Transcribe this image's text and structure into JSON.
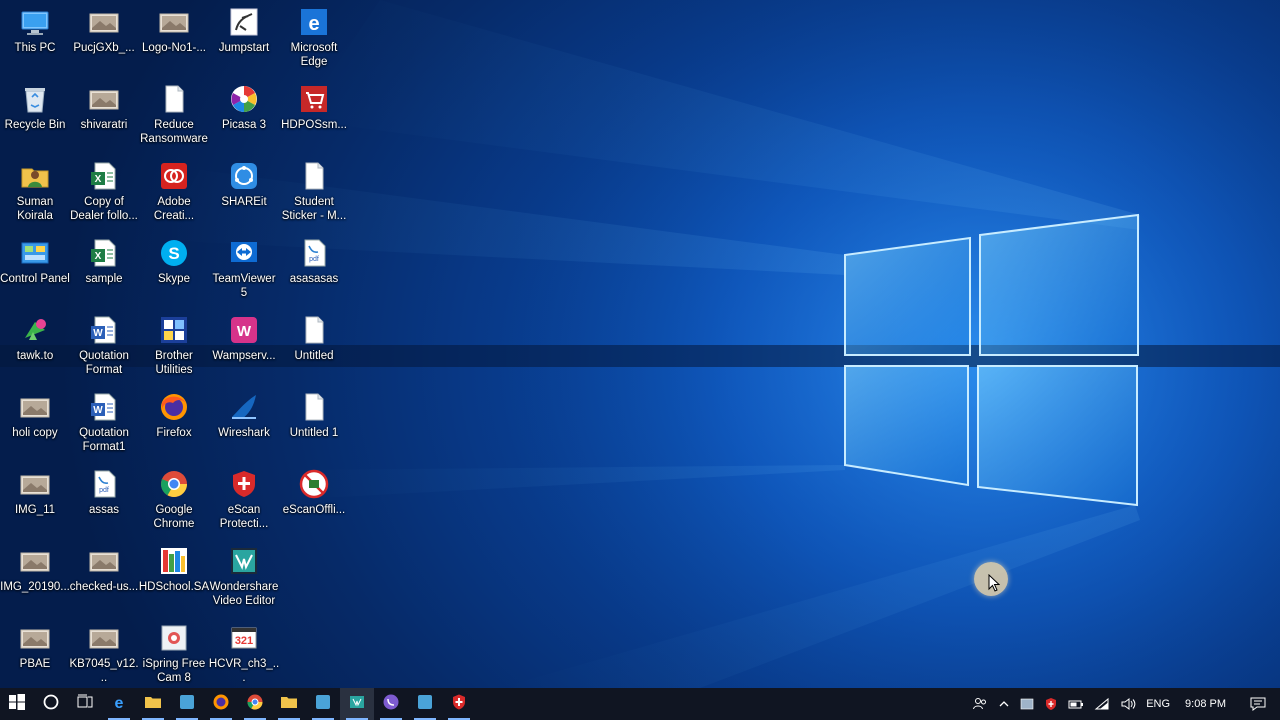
{
  "desktop_icons": [
    [
      {
        "label": "This PC",
        "icon": "this-pc-icon"
      },
      {
        "label": "Recycle Bin",
        "icon": "recycle-bin-icon"
      },
      {
        "label": "Suman Koirala",
        "icon": "user-folder-icon"
      },
      {
        "label": "Control Panel",
        "icon": "control-panel-icon"
      },
      {
        "label": "tawk.to",
        "icon": "tawk-icon"
      },
      {
        "label": "holi copy",
        "icon": "image-file-icon"
      },
      {
        "label": "IMG_11",
        "icon": "image-file-icon"
      },
      {
        "label": "IMG_20190...",
        "icon": "image-file-icon"
      },
      {
        "label": "PBAE",
        "icon": "image-file-icon"
      }
    ],
    [
      {
        "label": "PucjGXb_...",
        "icon": "image-file-icon"
      },
      {
        "label": "shivaratri",
        "icon": "image-file-icon"
      },
      {
        "label": "Copy of Dealer follo...",
        "icon": "excel-file-icon"
      },
      {
        "label": "sample",
        "icon": "excel-file-icon"
      },
      {
        "label": "Quotation Format",
        "icon": "word-file-icon"
      },
      {
        "label": "Quotation Format1",
        "icon": "word-file-icon"
      },
      {
        "label": "assas",
        "icon": "pdf-file-icon"
      },
      {
        "label": "checked-us...",
        "icon": "image-file-icon"
      },
      {
        "label": "KB7045_v12...",
        "icon": "image-file-icon"
      }
    ],
    [
      {
        "label": "Logo-No1-...",
        "icon": "image-file-icon"
      },
      {
        "label": "Reduce Ransomware",
        "icon": "document-icon"
      },
      {
        "label": "Adobe Creati...",
        "icon": "adobe-cc-icon"
      },
      {
        "label": "Skype",
        "icon": "skype-icon"
      },
      {
        "label": "Brother Utilities",
        "icon": "brother-icon"
      },
      {
        "label": "Firefox",
        "icon": "firefox-icon"
      },
      {
        "label": "Google Chrome",
        "icon": "chrome-icon"
      },
      {
        "label": "HDSchool.SA",
        "icon": "hdschool-icon"
      },
      {
        "label": "iSpring Free Cam 8",
        "icon": "ispring-icon"
      }
    ],
    [
      {
        "label": "Jumpstart",
        "icon": "jumpstart-icon"
      },
      {
        "label": "Picasa 3",
        "icon": "picasa-icon"
      },
      {
        "label": "SHAREit",
        "icon": "shareit-icon"
      },
      {
        "label": "TeamViewer 5",
        "icon": "teamviewer-icon"
      },
      {
        "label": "Wampserv...",
        "icon": "wampserver-icon"
      },
      {
        "label": "Wireshark",
        "icon": "wireshark-icon"
      },
      {
        "label": "eScan Protecti...",
        "icon": "escan-icon"
      },
      {
        "label": "Wondershare Video Editor",
        "icon": "wondershare-icon"
      },
      {
        "label": "HCVR_ch3_...",
        "icon": "video-file-icon"
      }
    ],
    [
      {
        "label": "Microsoft Edge",
        "icon": "edge-icon"
      },
      {
        "label": "HDPOSsm...",
        "icon": "hdpos-icon"
      },
      {
        "label": "Student Sticker - M...",
        "icon": "document-icon"
      },
      {
        "label": "asasasas",
        "icon": "pdf-file-icon"
      },
      {
        "label": "Untitled",
        "icon": "document-icon"
      },
      {
        "label": "Untitled 1",
        "icon": "document-icon"
      },
      {
        "label": "eScanOffli...",
        "icon": "escan-offline-icon"
      }
    ]
  ],
  "taskbar": {
    "pinned": [
      {
        "name": "start-button",
        "icon": "windows-logo-icon"
      },
      {
        "name": "cortana-button",
        "icon": "cortana-circle-icon"
      },
      {
        "name": "task-view-button",
        "icon": "task-view-icon"
      },
      {
        "name": "taskbar-edge",
        "icon": "edge-icon"
      },
      {
        "name": "taskbar-file-explorer",
        "icon": "folder-icon"
      },
      {
        "name": "taskbar-app-green",
        "icon": "app-icon"
      },
      {
        "name": "taskbar-firefox",
        "icon": "firefox-icon"
      },
      {
        "name": "taskbar-chrome",
        "icon": "chrome-icon"
      },
      {
        "name": "taskbar-folder-yellow",
        "icon": "folder-icon"
      },
      {
        "name": "taskbar-app-settings",
        "icon": "app-icon"
      },
      {
        "name": "taskbar-video-app",
        "icon": "video-editor-icon"
      },
      {
        "name": "taskbar-viber",
        "icon": "viber-icon"
      },
      {
        "name": "taskbar-app-teal",
        "icon": "app-icon"
      },
      {
        "name": "taskbar-escan",
        "icon": "escan-icon"
      }
    ],
    "tray": {
      "language": "ENG",
      "time": "9:08 PM"
    }
  }
}
